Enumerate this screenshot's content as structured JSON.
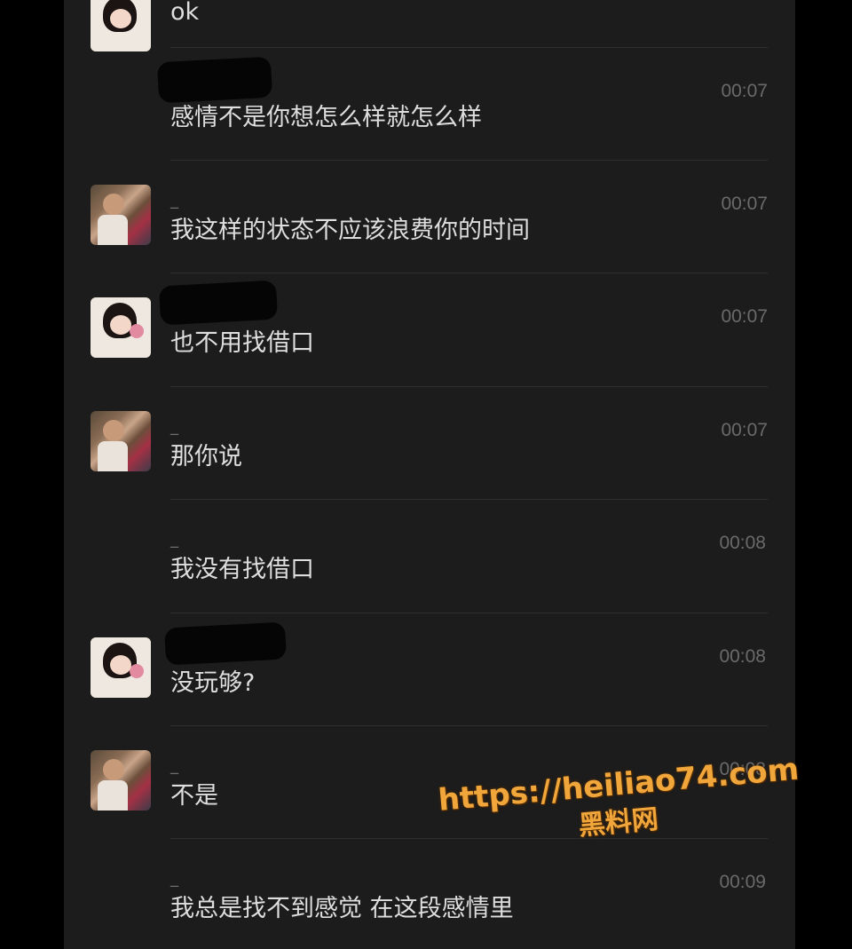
{
  "chat": {
    "first": {
      "text": "ok"
    },
    "messages": [
      {
        "name": "",
        "text": "感情不是你想怎么样就怎么样",
        "time": "00:07",
        "avatar": "none"
      },
      {
        "name": "_",
        "text": "我这样的状态不应该浪费你的时间",
        "time": "00:07",
        "avatar": "man-photo"
      },
      {
        "name": "",
        "text": "也不用找借口",
        "time": "00:07",
        "avatar": "anime-girl"
      },
      {
        "name": "_",
        "text": "那你说",
        "time": "00:07",
        "avatar": "man-photo"
      },
      {
        "name": "_",
        "text": "我没有找借口",
        "time": "00:08",
        "avatar": "none"
      },
      {
        "name": "",
        "text": "没玩够?",
        "time": "00:08",
        "avatar": "anime-girl"
      },
      {
        "name": "_",
        "text": "不是",
        "time": "00:08",
        "avatar": "man-photo"
      },
      {
        "name": "_",
        "text": "我总是找不到感觉 在这段感情里",
        "time": "00:09",
        "avatar": "none"
      }
    ]
  },
  "watermark": {
    "url": "https://heiliao74.com",
    "name": "黑料网"
  },
  "colors": {
    "background": "#1c1c1c",
    "text": "#dedede",
    "muted": "#6a6a6a",
    "watermark": "#f0a63a"
  }
}
